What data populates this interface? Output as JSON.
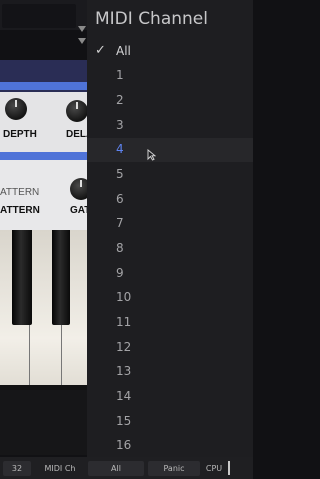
{
  "midi_menu": {
    "title": "MIDI Channel",
    "selected_item": "All",
    "highlighted_item": "4",
    "items": [
      {
        "label": "All",
        "checked": true
      },
      {
        "label": "1"
      },
      {
        "label": "2"
      },
      {
        "label": "3"
      },
      {
        "label": "4",
        "highlighted": true
      },
      {
        "label": "5"
      },
      {
        "label": "6"
      },
      {
        "label": "7"
      },
      {
        "label": "8"
      },
      {
        "label": "9"
      },
      {
        "label": "10"
      },
      {
        "label": "11"
      },
      {
        "label": "12"
      },
      {
        "label": "13"
      },
      {
        "label": "14"
      },
      {
        "label": "15"
      },
      {
        "label": "16"
      }
    ],
    "check_glyph": "✓"
  },
  "synth_panel": {
    "knob_labels": [
      "DEPTH",
      "DELA"
    ],
    "pattern_section_label": "ATTERN",
    "pattern_knob_labels": [
      "ATTERN",
      "GAT"
    ]
  },
  "status_bar": {
    "value_32": "32",
    "midi_ch_label": "MIDI Ch",
    "midi_ch_value": "All",
    "panic_label": "Panic",
    "cpu_label": "CPU"
  },
  "colors": {
    "menu_bg": "#1e1e21",
    "highlight_bg": "#27272a",
    "highlight_text": "#5e83f0",
    "panel_blue": "#4f73d8",
    "panel_navy": "#2a2d55"
  }
}
